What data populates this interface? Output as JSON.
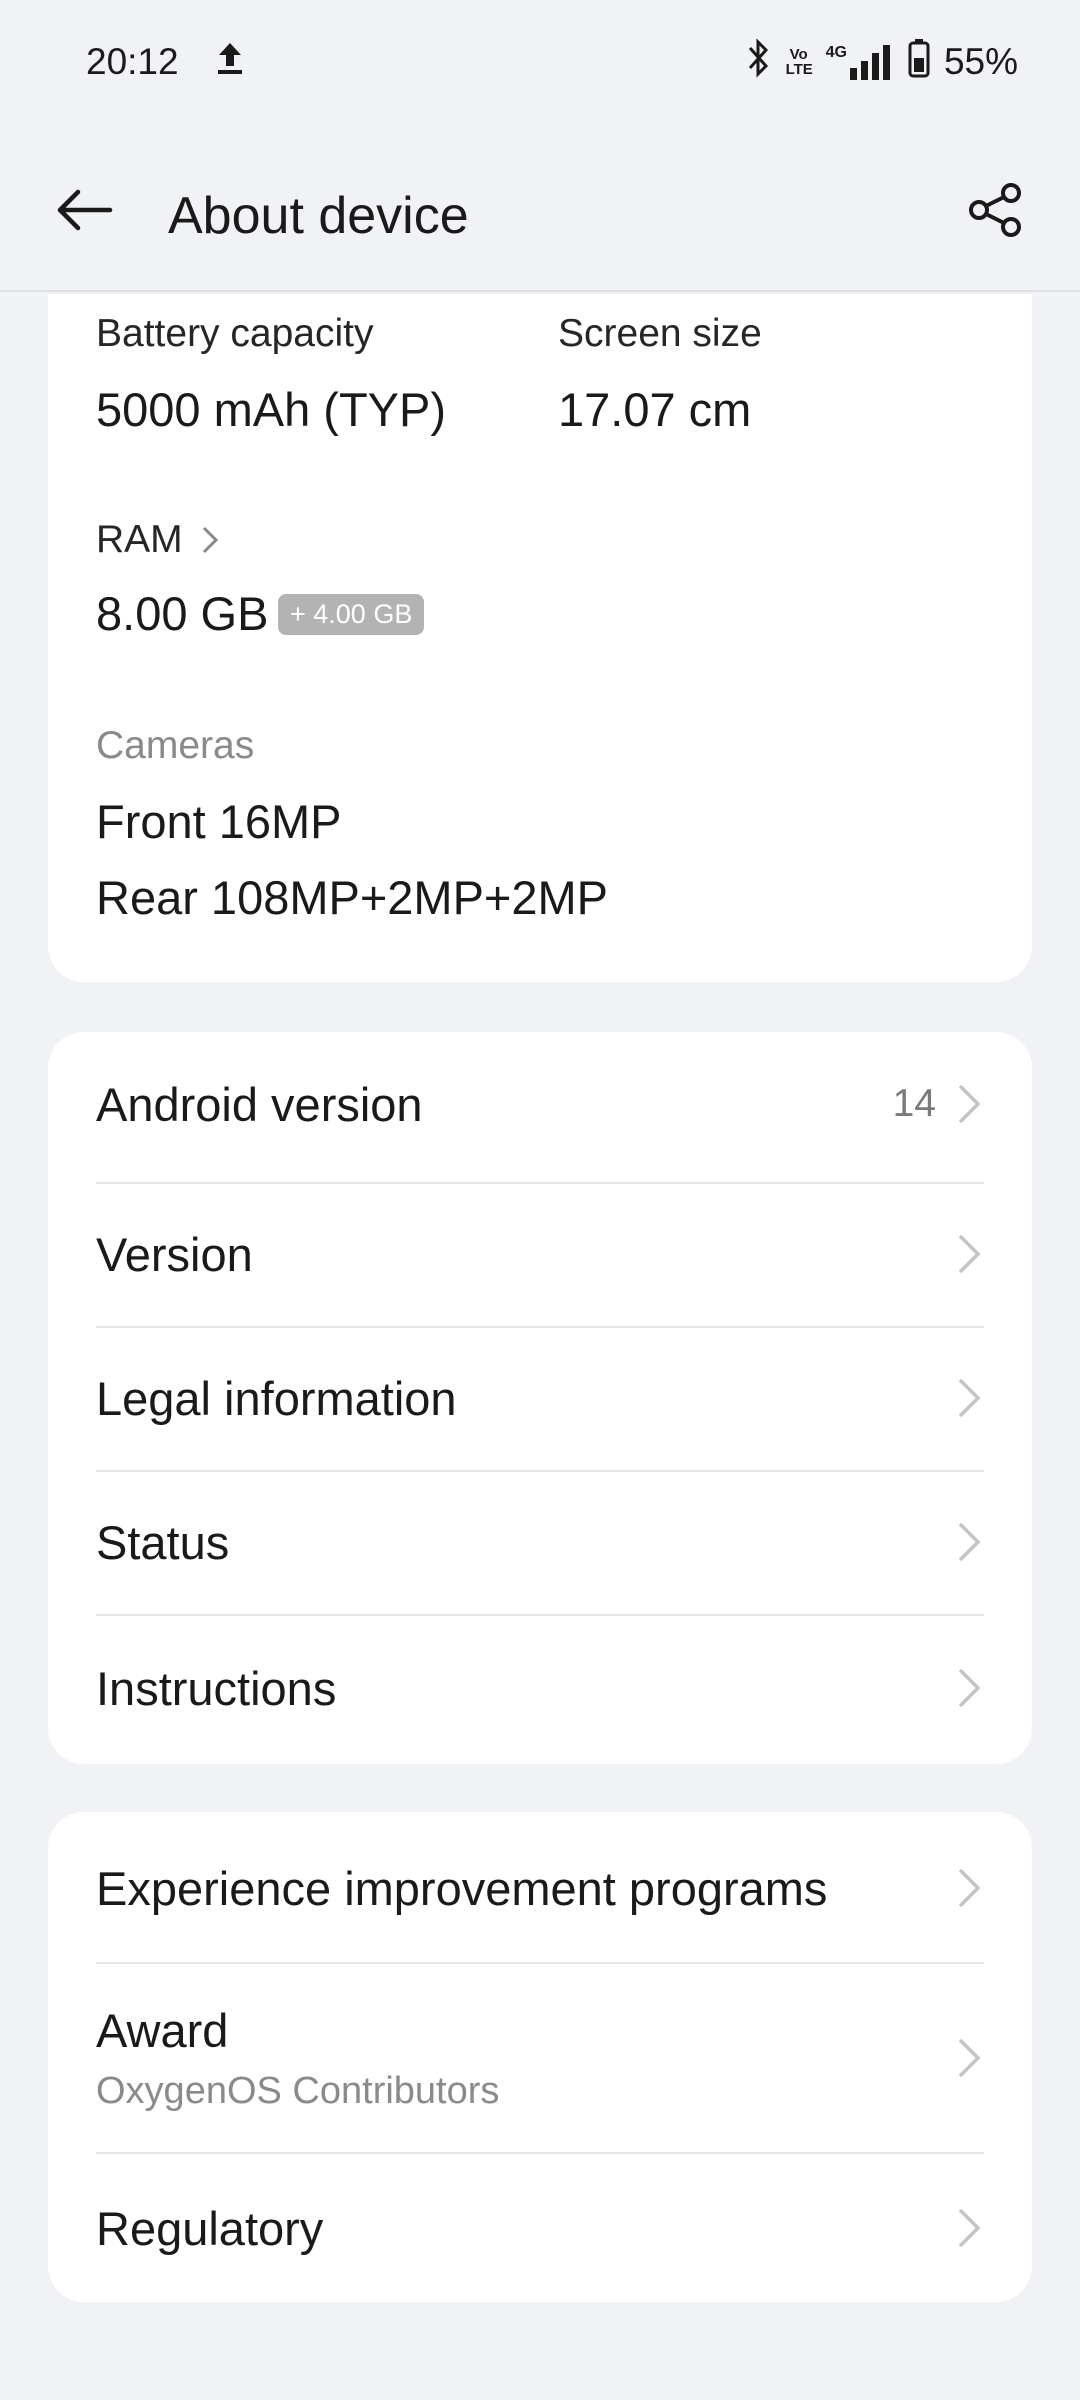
{
  "status_bar": {
    "time": "20:12",
    "battery_percent": "55%",
    "network_label": "4G",
    "volte_label": "Vo LTE"
  },
  "app_bar": {
    "title": "About device"
  },
  "specs": {
    "battery_label": "Battery capacity",
    "battery_value": "5000 mAh (TYP)",
    "screen_label": "Screen size",
    "screen_value": "17.07 cm",
    "ram_label": "RAM",
    "ram_value": "8.00 GB",
    "ram_extra": "+ 4.00 GB",
    "cameras_label": "Cameras",
    "front_camera": "Front 16MP",
    "rear_camera": "Rear 108MP+2MP+2MP"
  },
  "system_items": [
    {
      "label": "Android version",
      "value": "14"
    },
    {
      "label": "Version"
    },
    {
      "label": "Legal information"
    },
    {
      "label": "Status"
    },
    {
      "label": "Instructions"
    }
  ],
  "more_items": [
    {
      "label": "Experience improvement programs"
    },
    {
      "label": "Award",
      "sublabel": "OxygenOS Contributors"
    },
    {
      "label": "Regulatory"
    }
  ],
  "colors": {
    "background": "#f1f2f5",
    "card": "#ffffff",
    "chip": "#b3b3b3"
  }
}
